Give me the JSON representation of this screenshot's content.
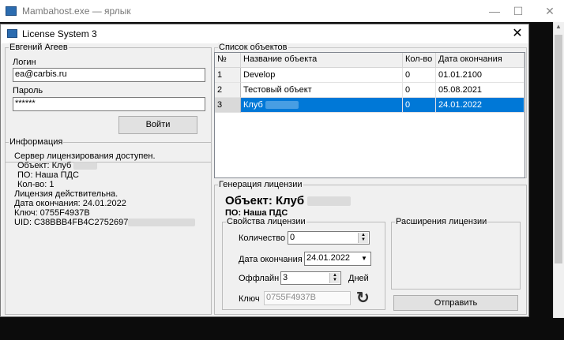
{
  "outer_window": {
    "title": "Mambahost.exe — ярлык",
    "minimize": "—",
    "maximize": "☐",
    "close": "✕"
  },
  "dialog": {
    "title": "License System 3",
    "close": "✕"
  },
  "user_group": {
    "legend": "Евгений Агеев",
    "login_label": "Логин",
    "login_value": "ea@carbis.ru",
    "password_label": "Пароль",
    "password_value": "******",
    "login_button": "Войти"
  },
  "info_group": {
    "legend": "Информация",
    "lines": [
      "Сервер лицензирования доступен.",
      "Объект: Клуб",
      "ПО: Наша ПДС",
      "Кол-во: 1",
      "Лицензия действительна.",
      "Дата окончания: 24.01.2022",
      "Ключ: 0755F4937B",
      "UID: C38BBB4FB4C2752697"
    ]
  },
  "objects_group": {
    "legend": "Список объектов",
    "columns": [
      "№",
      "Название объекта",
      "Кол-во",
      "Дата окончания"
    ],
    "rows": [
      {
        "num": "1",
        "name": "Develop",
        "count": "0",
        "date": "01.01.2100"
      },
      {
        "num": "2",
        "name": "Тестовый объект",
        "count": "0",
        "date": "05.08.2021"
      },
      {
        "num": "3",
        "name": "Клуб",
        "count": "0",
        "date": "24.01.2022"
      }
    ]
  },
  "generation_group": {
    "legend": "Генерация лицензии",
    "object_title": "Объект: Клуб",
    "software": "ПО: Наша ПДС",
    "props_legend": "Свойства лицензии",
    "quantity_label": "Количество",
    "quantity_value": "0",
    "expiry_label": "Дата окончания",
    "expiry_value": "24.01.2022",
    "offline_label": "Оффлайн",
    "offline_value": "3",
    "offline_unit": "Дней",
    "key_label": "Ключ",
    "key_value": "0755F4937B",
    "extensions_legend": "Расширения лицензии",
    "send_button": "Отправить"
  },
  "colors": {
    "selection": "#0078d7",
    "console_background": "#0c0c0c"
  }
}
